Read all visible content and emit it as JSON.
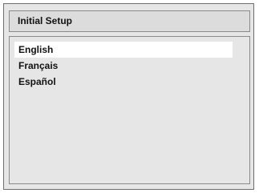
{
  "window": {
    "title": "Initial Setup"
  },
  "menu": {
    "items": [
      {
        "label": "English",
        "selected": true
      },
      {
        "label": "Français",
        "selected": false
      },
      {
        "label": "Español",
        "selected": false
      }
    ]
  },
  "colors": {
    "background": "#e6e6e6",
    "selection": "#ffffff",
    "border": "#8a8a8a",
    "text": "#111111"
  }
}
